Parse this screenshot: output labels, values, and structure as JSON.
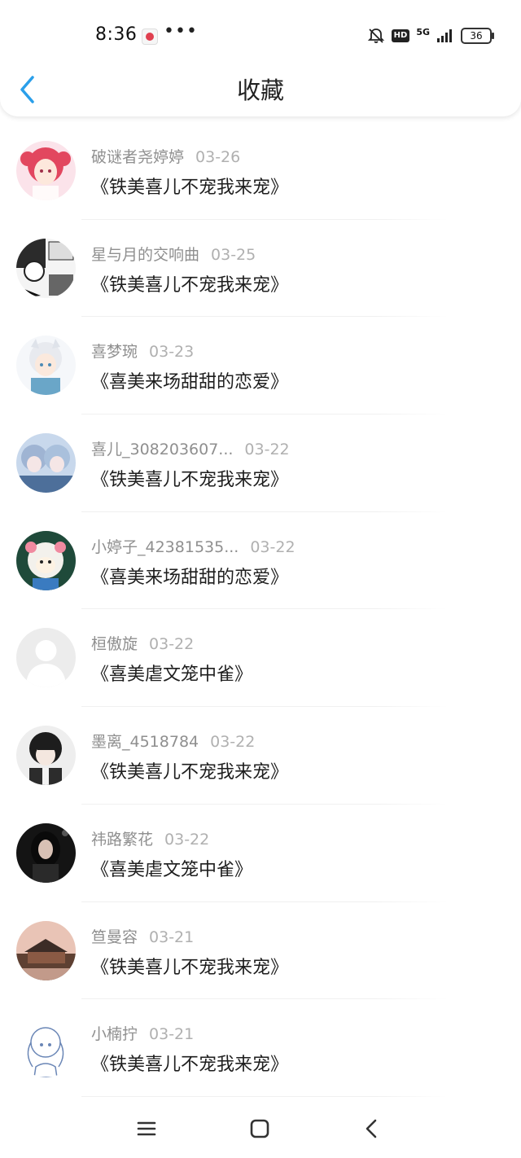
{
  "status_bar": {
    "time": "8:36",
    "more": "•••",
    "hd": "HD",
    "network": "5G",
    "battery": "36"
  },
  "header": {
    "title": "收藏",
    "back_icon": "chevron-left-icon",
    "accent_color": "#2a9fea"
  },
  "favorites": [
    {
      "user": "破谜者尧婷婷",
      "date": "03-26",
      "title": "《铁美喜儿不宠我来宠》",
      "avatar": "anime-girl-pink-hair"
    },
    {
      "user": "星与月的交响曲",
      "date": "03-25",
      "title": "《铁美喜儿不宠我来宠》",
      "avatar": "manga-panel"
    },
    {
      "user": "喜梦琬",
      "date": "03-23",
      "title": "《喜美来场甜甜的恋爱》",
      "avatar": "white-hair-boy"
    },
    {
      "user": "喜儿_308203607...",
      "date": "03-22",
      "title": "《铁美喜儿不宠我来宠》",
      "avatar": "blue-anime-duo"
    },
    {
      "user": "小婷子_42381535...",
      "date": "03-22",
      "title": "《喜美来场甜甜的恋爱》",
      "avatar": "cartoon-sheep"
    },
    {
      "user": "桓傲旋",
      "date": "03-22",
      "title": "《喜美虐文笼中雀》",
      "avatar": "default-avatar"
    },
    {
      "user": "墨离_4518784",
      "date": "03-22",
      "title": "《铁美喜儿不宠我来宠》",
      "avatar": "dark-hair-boy"
    },
    {
      "user": "祎路繁花",
      "date": "03-22",
      "title": "《喜美虐文笼中雀》",
      "avatar": "dark-portrait-girl"
    },
    {
      "user": "笪曼容",
      "date": "03-21",
      "title": "《铁美喜儿不宠我来宠》",
      "avatar": "landscape-pavilion"
    },
    {
      "user": "小楠拧",
      "date": "03-21",
      "title": "《铁美喜儿不宠我来宠》",
      "avatar": "sketch-girl"
    }
  ],
  "nav_bar": {
    "menu_icon": "menu-icon",
    "home_icon": "home-square-icon",
    "back_icon": "back-triangle-icon"
  }
}
